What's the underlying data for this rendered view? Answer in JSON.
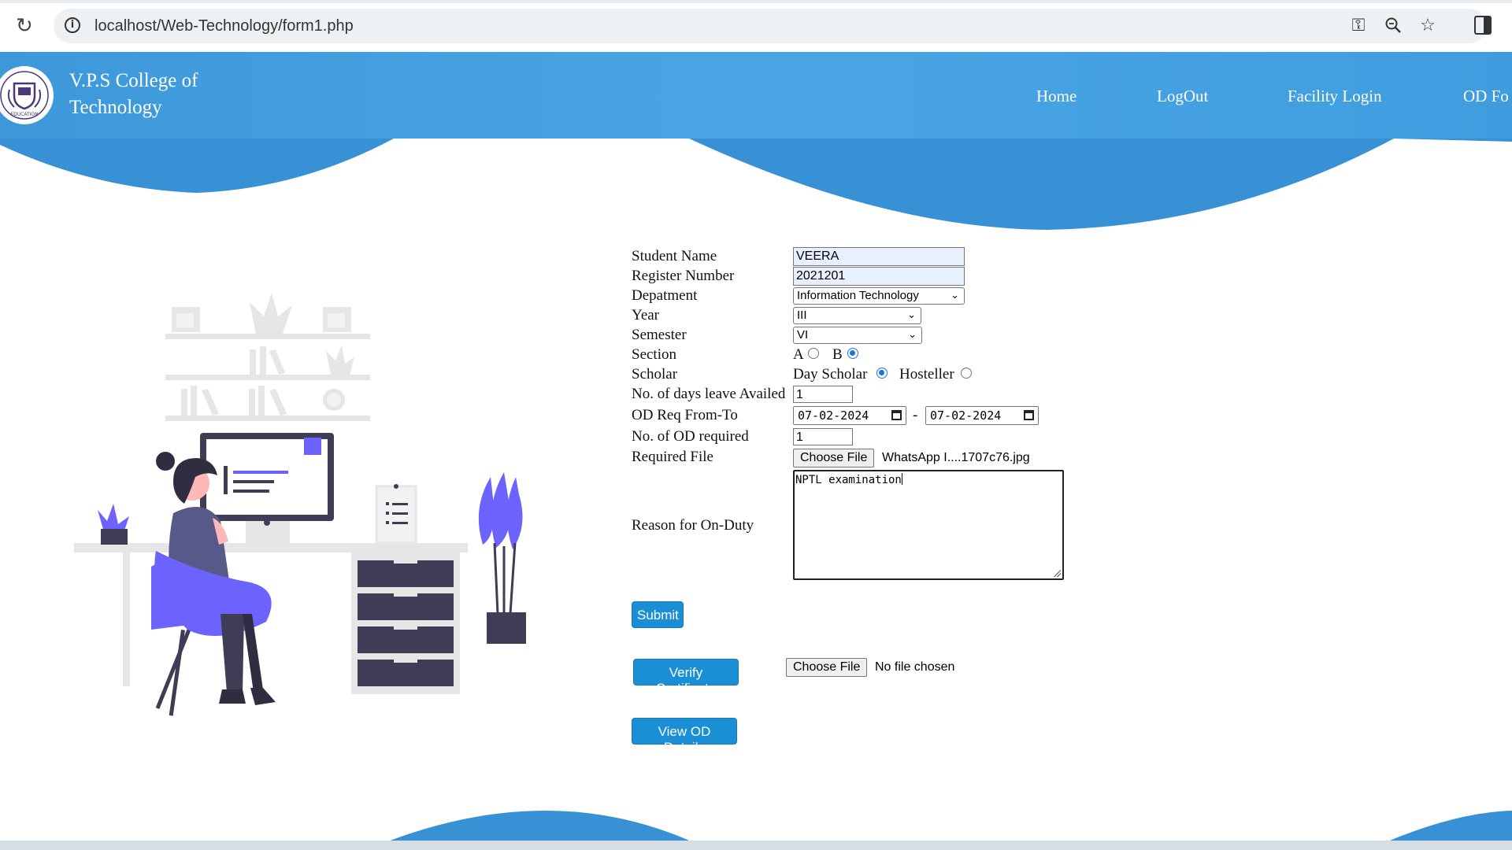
{
  "browser": {
    "url": "localhost/Web-Technology/form1.php"
  },
  "header": {
    "brand_line1": "V.P.S College of",
    "brand_line2": "Technology",
    "logo_text": "EDUCATION",
    "nav": [
      "Home",
      "LogOut",
      "Facility Login",
      "OD Fo"
    ]
  },
  "form": {
    "labels": {
      "student_name": "Student Name",
      "register_number": "Register Number",
      "department": "Depatment",
      "year": "Year",
      "semester": "Semester",
      "section": "Section",
      "scholar": "Scholar",
      "days_leave": "No. of days leave Availed",
      "od_from_to": "OD Req From-To",
      "od_required": "No. of OD required",
      "required_file": "Required File",
      "reason": "Reason for On-Duty"
    },
    "values": {
      "student_name": "VEERA",
      "register_number": "2021201",
      "department": "Information Technology",
      "year": "III",
      "semester": "VI",
      "section_a": "A",
      "section_b": "B",
      "section_selected": "B",
      "day_scholar": "Day Scholar",
      "hosteller": "Hosteller",
      "scholar_selected": "Day Scholar",
      "days_leave": "1",
      "od_from": "07-02-2024",
      "od_to": "07-02-2024",
      "date_separator": "-",
      "od_required": "1",
      "choose_file": "Choose File",
      "required_file_name": "WhatsApp I....1707c76.jpg",
      "reason": "NPTL examination"
    },
    "submit_label": "Submit",
    "verify_label": "Verify Certificate",
    "verify_choose_file": "Choose File",
    "verify_no_file": "No file chosen",
    "view_od_label": "View OD Details"
  },
  "colors": {
    "header_blue": "#4aa5e4",
    "wave_blue": "#3791d4",
    "button_blue": "#1a8fd6",
    "illustration_purple": "#6c63ff"
  }
}
